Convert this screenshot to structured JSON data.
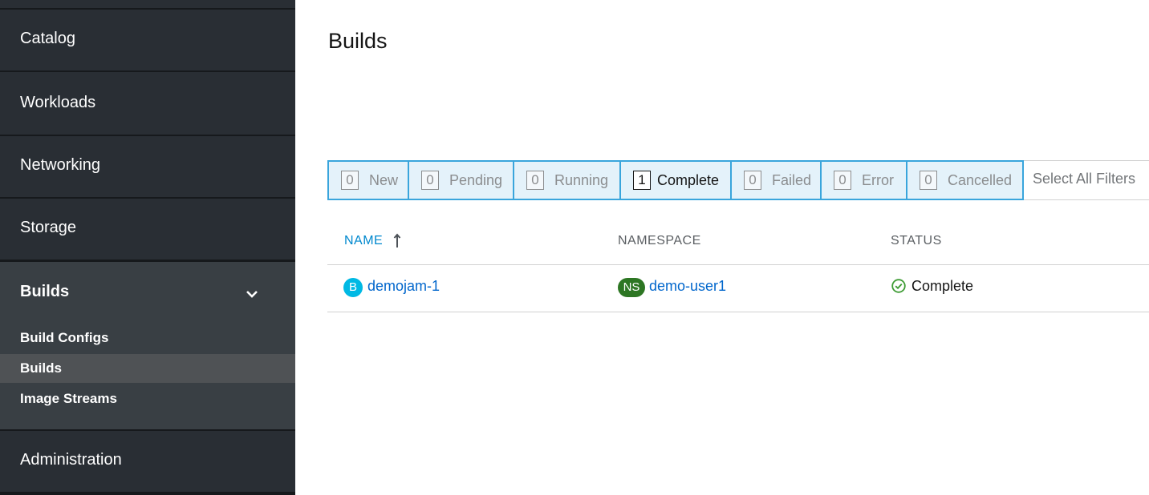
{
  "sidebar": {
    "items": [
      {
        "label": "Catalog"
      },
      {
        "label": "Workloads"
      },
      {
        "label": "Networking"
      },
      {
        "label": "Storage"
      },
      {
        "label": "Builds"
      },
      {
        "label": "Administration"
      }
    ],
    "builds_subitems": [
      {
        "label": "Build Configs"
      },
      {
        "label": "Builds"
      },
      {
        "label": "Image Streams"
      }
    ]
  },
  "page": {
    "title": "Builds"
  },
  "filters": [
    {
      "count": "0",
      "label": "New"
    },
    {
      "count": "0",
      "label": "Pending"
    },
    {
      "count": "0",
      "label": "Running"
    },
    {
      "count": "1",
      "label": "Complete"
    },
    {
      "count": "0",
      "label": "Failed"
    },
    {
      "count": "0",
      "label": "Error"
    },
    {
      "count": "0",
      "label": "Cancelled"
    }
  ],
  "select_all_label": "Select All Filters",
  "table": {
    "columns": [
      "NAME",
      "NAMESPACE",
      "STATUS"
    ],
    "rows": [
      {
        "name_badge": "B",
        "name": "demojam-1",
        "namespace_badge": "NS",
        "namespace": "demo-user1",
        "status": "Complete"
      }
    ]
  },
  "colors": {
    "sidebar_bg": "#292e34",
    "accent_blue": "#0088ce",
    "build_badge": "#00b9e4",
    "ns_badge": "#2d7623",
    "status_ok": "#3f9c35"
  },
  "icons": {
    "chevron": "chevron-down-icon",
    "sort": "sort-ascending-icon",
    "status": "check-circle-icon"
  }
}
